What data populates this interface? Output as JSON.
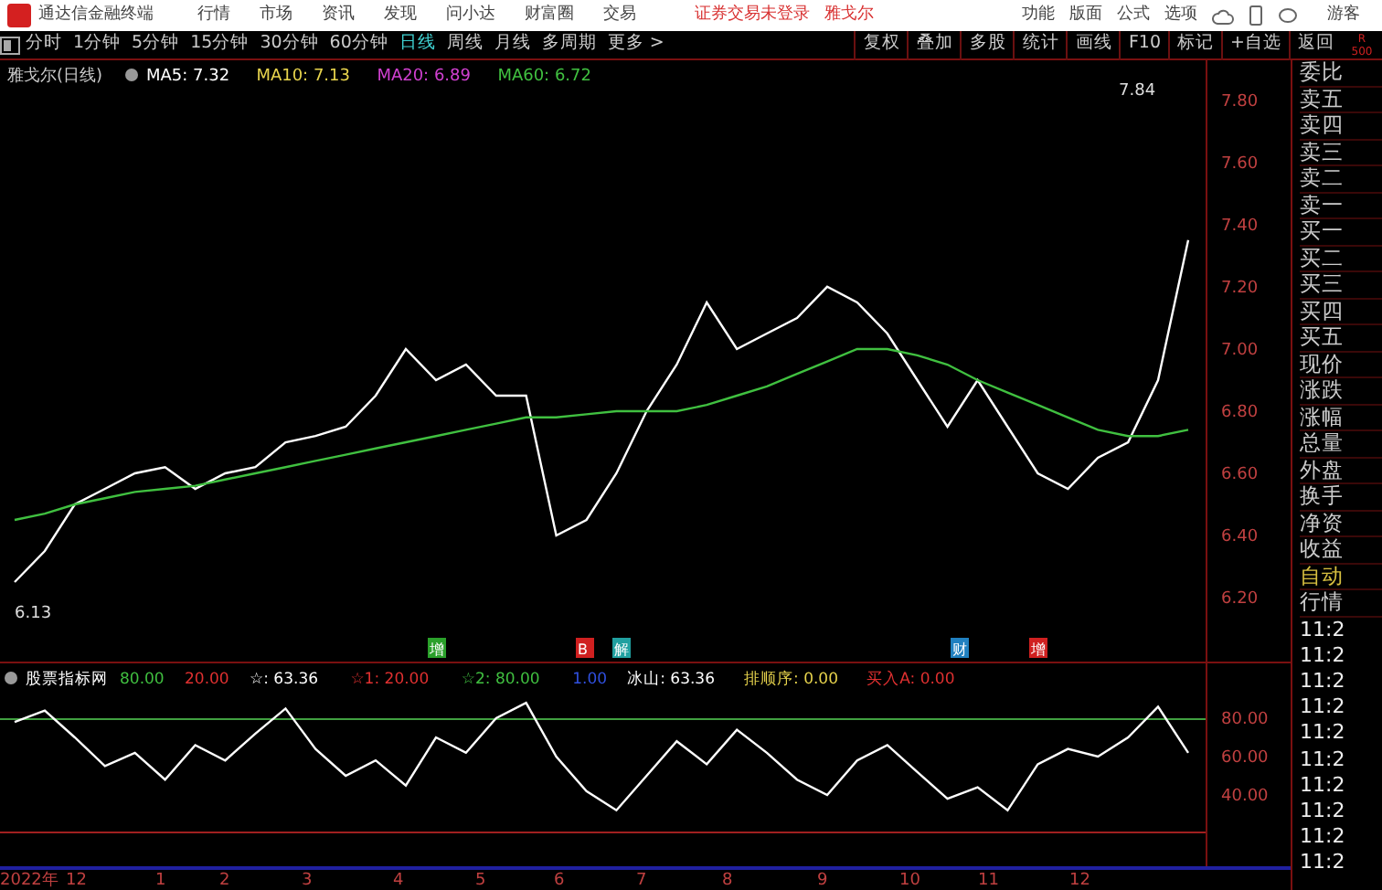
{
  "title_bar": {
    "app_name": "通达信金融终端",
    "menus": [
      "行情",
      "市场",
      "资讯",
      "发现",
      "问小达",
      "财富圈",
      "交易"
    ],
    "login_notice": "证券交易未登录",
    "stock_name": "雅戈尔",
    "tools": [
      "功能",
      "版面",
      "公式",
      "选项"
    ],
    "user": "游客"
  },
  "period_bar": {
    "periods": [
      {
        "label": "分时",
        "selected": false
      },
      {
        "label": "1分钟",
        "selected": false
      },
      {
        "label": "5分钟",
        "selected": false
      },
      {
        "label": "15分钟",
        "selected": false
      },
      {
        "label": "30分钟",
        "selected": false
      },
      {
        "label": "60分钟",
        "selected": false
      },
      {
        "label": "日线",
        "selected": true
      },
      {
        "label": "周线",
        "selected": false
      },
      {
        "label": "月线",
        "selected": false
      },
      {
        "label": "多周期",
        "selected": false
      },
      {
        "label": "更多 >",
        "selected": false
      }
    ],
    "actions": [
      "复权",
      "叠加",
      "多股",
      "统计",
      "画线",
      "F10",
      "标记",
      "+自选",
      "返回"
    ],
    "corner": [
      "R",
      "500"
    ]
  },
  "price_chart": {
    "title": "雅戈尔(日线)",
    "indicators": [
      {
        "text": "MA5: 7.32",
        "color": "#ffffff"
      },
      {
        "text": "MA10: 7.13",
        "color": "#e8d44d"
      },
      {
        "text": "MA20: 6.89",
        "color": "#d040d0"
      },
      {
        "text": "MA60: 6.72",
        "color": "#40c040"
      }
    ],
    "markers": [
      {
        "text": "增",
        "color": "#2aa02a"
      },
      {
        "text": "B",
        "color": "#d02020"
      },
      {
        "text": "解",
        "color": "#20a0a0"
      },
      {
        "text": "财",
        "color": "#2080c0"
      },
      {
        "text": "增",
        "color": "#d02020"
      }
    ],
    "price_labels": [
      "7.84",
      "6.13"
    ],
    "chart_data": {
      "type": "line",
      "series": [
        {
          "color": "#ffffff",
          "values": [
            6.25,
            6.35,
            6.5,
            6.55,
            6.6,
            6.62,
            6.55,
            6.6,
            6.62,
            6.7,
            6.72,
            6.75,
            6.85,
            7.0,
            6.9,
            6.95,
            6.85,
            6.85,
            6.4,
            6.45,
            6.6,
            6.8,
            6.95,
            7.15,
            7.0,
            7.05,
            7.1,
            7.2,
            7.15,
            7.05,
            6.9,
            6.75,
            6.9,
            6.75,
            6.6,
            6.55,
            6.65,
            6.7,
            6.9,
            7.35
          ]
        },
        {
          "color": "#40c040",
          "values": [
            6.45,
            6.47,
            6.5,
            6.52,
            6.54,
            6.55,
            6.56,
            6.58,
            6.6,
            6.62,
            6.64,
            6.66,
            6.68,
            6.7,
            6.72,
            6.74,
            6.76,
            6.78,
            6.78,
            6.79,
            6.8,
            6.8,
            6.8,
            6.82,
            6.85,
            6.88,
            6.92,
            6.96,
            7.0,
            7.0,
            6.98,
            6.95,
            6.9,
            6.86,
            6.82,
            6.78,
            6.74,
            6.72,
            6.72,
            6.74
          ]
        }
      ],
      "ylim": [
        5.994,
        7.929
      ],
      "yticks": [
        {
          "value": 7.8,
          "label": "7.80"
        },
        {
          "value": 7.6,
          "label": "7.60"
        },
        {
          "value": 7.4,
          "label": "7.40"
        },
        {
          "value": 7.2,
          "label": "7.20"
        },
        {
          "value": 7.0,
          "label": "7.00"
        },
        {
          "value": 6.8,
          "label": "6.80"
        },
        {
          "value": 6.6,
          "label": "6.60"
        },
        {
          "value": 6.4,
          "label": "6.40"
        },
        {
          "value": 6.2,
          "label": "6.20"
        }
      ]
    }
  },
  "indicator_panel": {
    "items": [
      {
        "text": "股票指标网",
        "color": "#ffffff"
      },
      {
        "text": "80.00",
        "color": "#40c040"
      },
      {
        "text": "20.00",
        "color": "#e03030"
      },
      {
        "text": "☆: 63.36",
        "color": "#ffffff"
      },
      {
        "text": "☆1: 20.00",
        "color": "#e03030"
      },
      {
        "text": "☆2: 80.00",
        "color": "#40c040"
      },
      {
        "text": "1.00",
        "color": "#3050e0"
      },
      {
        "text": "冰山: 63.36",
        "color": "#ffffff"
      },
      {
        "text": "排顺序: 0.00",
        "color": "#e8d44d"
      },
      {
        "text": "买入A: 0.00",
        "color": "#e03030"
      }
    ],
    "chart_data": {
      "type": "line",
      "series": [
        {
          "color": "#ffffff",
          "values": [
            78,
            84,
            70,
            55,
            62,
            48,
            66,
            58,
            72,
            85,
            64,
            50,
            58,
            45,
            70,
            62,
            80,
            88,
            60,
            42,
            32,
            50,
            68,
            56,
            74,
            62,
            48,
            40,
            58,
            66,
            52,
            38,
            44,
            32,
            56,
            64,
            60,
            70,
            86,
            62
          ]
        }
      ],
      "ylim": [
        2.86,
        109.52
      ],
      "yticks": [
        {
          "value": 80,
          "label": "80.00"
        },
        {
          "value": 60,
          "label": "60.00"
        },
        {
          "value": 40,
          "label": "40.00"
        }
      ]
    }
  },
  "x_axis": [
    "2022年",
    "12",
    "1",
    "2",
    "3",
    "4",
    "5",
    "6",
    "7",
    "8",
    "9",
    "10",
    "11",
    "12"
  ],
  "quote_panel": {
    "labels": [
      {
        "text": "委比",
        "kind": "label"
      },
      {
        "text": "卖五",
        "kind": "label"
      },
      {
        "text": "卖四",
        "kind": "label"
      },
      {
        "text": "卖三",
        "kind": "label"
      },
      {
        "text": "卖二",
        "kind": "label"
      },
      {
        "text": "卖一",
        "kind": "label"
      },
      {
        "text": "买一",
        "kind": "label"
      },
      {
        "text": "买二",
        "kind": "label"
      },
      {
        "text": "买三",
        "kind": "label"
      },
      {
        "text": "买四",
        "kind": "label"
      },
      {
        "text": "买五",
        "kind": "label"
      },
      {
        "text": "现价",
        "kind": "label"
      },
      {
        "text": "涨跌",
        "kind": "label"
      },
      {
        "text": "涨幅",
        "kind": "label"
      },
      {
        "text": "总量",
        "kind": "label"
      },
      {
        "text": "外盘",
        "kind": "label"
      },
      {
        "text": "换手",
        "kind": "label"
      },
      {
        "text": "净资",
        "kind": "label"
      },
      {
        "text": "收益",
        "kind": "label"
      },
      {
        "text": "自动",
        "kind": "toggle"
      },
      {
        "text": "行情",
        "kind": "label"
      }
    ],
    "times": [
      "11:2",
      "11:2",
      "11:2",
      "11:2",
      "11:2",
      "11:2",
      "11:2",
      "11:2",
      "11:2",
      "11:2"
    ]
  }
}
